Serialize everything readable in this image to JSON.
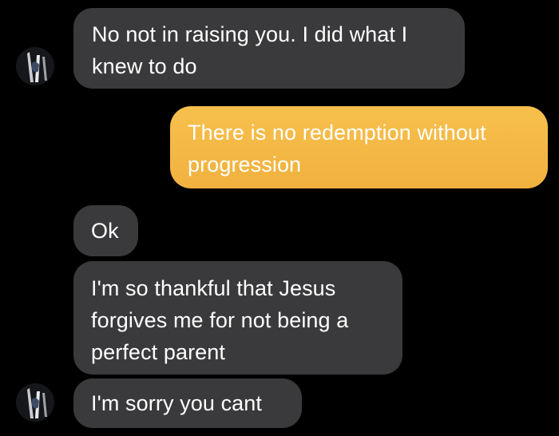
{
  "thread": {
    "messages": [
      {
        "sender": "other",
        "text": "No not in raising you. I did what I knew to do"
      },
      {
        "sender": "me",
        "text": "There is no redemption without progression"
      },
      {
        "sender": "other",
        "text": "Ok"
      },
      {
        "sender": "other",
        "text": "I'm so thankful that Jesus forgives me for not being a perfect parent"
      },
      {
        "sender": "other",
        "text": "I'm sorry you cant"
      }
    ]
  },
  "colors": {
    "background": "#000000",
    "incoming_bubble": "#3a3a3c",
    "outgoing_bubble": "#f2b441",
    "text": "#ffffff"
  },
  "avatar": {
    "icon": "contact-avatar-icon"
  }
}
